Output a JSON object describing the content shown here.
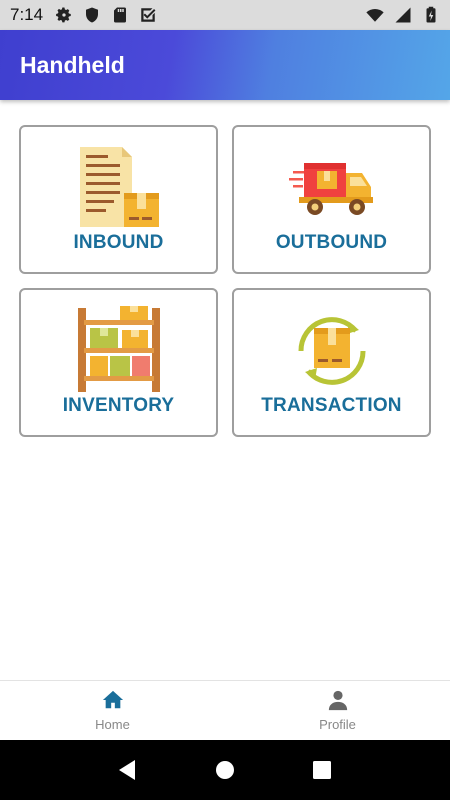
{
  "status_bar": {
    "time": "7:14",
    "left_icons": [
      "settings-icon",
      "shield-icon",
      "sd-card-icon",
      "checkbox-icon"
    ],
    "right_icons": [
      "wifi-icon",
      "signal-icon",
      "battery-charging-icon"
    ]
  },
  "app_bar": {
    "title": "Handheld",
    "gradient": [
      "#3f3fcf",
      "#54a6e8"
    ]
  },
  "tiles": [
    {
      "label": "INBOUND",
      "icon": "document-box-icon"
    },
    {
      "label": "OUTBOUND",
      "icon": "delivery-truck-icon"
    },
    {
      "label": "INVENTORY",
      "icon": "shelf-icon"
    },
    {
      "label": "TRANSACTION",
      "icon": "box-cycle-icon"
    }
  ],
  "bottom_nav": {
    "items": [
      {
        "label": "Home",
        "icon": "home-icon",
        "active": true
      },
      {
        "label": "Profile",
        "icon": "person-icon",
        "active": false
      }
    ]
  },
  "colors": {
    "tile_label": "#1a6e9a",
    "nav_active_icon": "#1a6e9a",
    "nav_inactive_icon": "#666666"
  }
}
